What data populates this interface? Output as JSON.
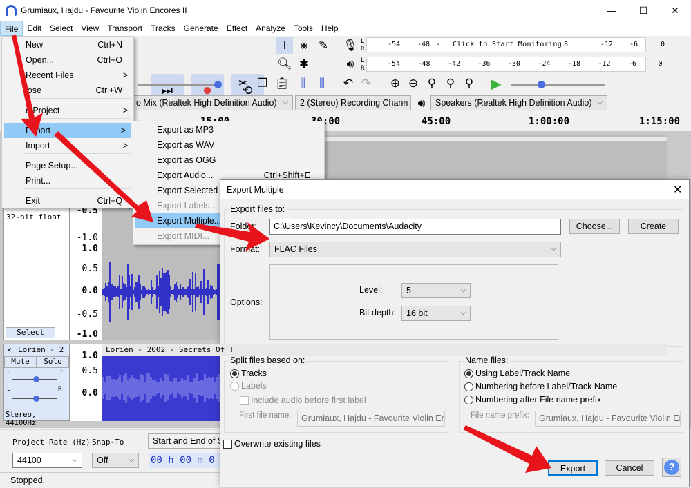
{
  "window": {
    "title": "Grumiaux, Hajdu - Favourite Violin Encores II",
    "minimize": "—",
    "maximize": "☐",
    "close": "✕"
  },
  "menubar": [
    "File",
    "Edit",
    "Select",
    "View",
    "Transport",
    "Tracks",
    "Generate",
    "Effect",
    "Analyze",
    "Tools",
    "Help"
  ],
  "file_menu": {
    "items": [
      {
        "label": "New",
        "shortcut": "Ctrl+N"
      },
      {
        "label": "Open...",
        "shortcut": "Ctrl+O"
      },
      {
        "label": "Recent Files",
        "submenu": ">"
      },
      {
        "label": "lose",
        "shortcut": "Ctrl+W"
      },
      {
        "label": "e Project",
        "submenu": ">"
      },
      {
        "label": "Export",
        "submenu": ">"
      },
      {
        "label": "Import",
        "submenu": ">"
      },
      {
        "label": "Page Setup..."
      },
      {
        "label": "Print..."
      },
      {
        "label": "Exit",
        "shortcut": "Ctrl+Q"
      }
    ]
  },
  "export_submenu": {
    "items": [
      {
        "label": "Export as MP3"
      },
      {
        "label": "Export as WAV"
      },
      {
        "label": "Export as OGG"
      },
      {
        "label": "Export Audio...",
        "shortcut": "Ctrl+Shift+E"
      },
      {
        "label": "Export Selected A"
      },
      {
        "label": "Export Labels...",
        "disabled": true
      },
      {
        "label": "Export Multiple...",
        "highlighted": true
      },
      {
        "label": "Export MIDI...",
        "disabled": true
      }
    ]
  },
  "meters": {
    "record_ticks": [
      "-54",
      "-48",
      "-",
      "8",
      "-12",
      "-6",
      "0"
    ],
    "record_hint": "Click to Start Monitoring",
    "playback_ticks": [
      "-54",
      "-48",
      "-42",
      "-36",
      "-30",
      "-24",
      "-18",
      "-12",
      "-6",
      "0"
    ],
    "lr": [
      "L",
      "R"
    ]
  },
  "devices": {
    "input": "o Mix (Realtek High Definition Audio)",
    "channels": "2 (Stereo) Recording Chann",
    "output": "Speakers (Realtek High Definition Audio)"
  },
  "timeline": [
    "15:00",
    "30:00",
    "45:00",
    "1:00:00",
    "1:15:00"
  ],
  "track1": {
    "info": "32-bit float",
    "select": "Select",
    "scale": [
      "-0.5",
      "-1.0",
      "1.0",
      "0.5",
      "0.0",
      "-0.5",
      "-1.0"
    ]
  },
  "track2": {
    "name": "Lorien - 2",
    "title": "Lorien - 2002 - Secrets Of T",
    "mute": "Mute",
    "solo": "Solo",
    "gain_minus": "-",
    "gain_plus": "+",
    "pan_l": "L",
    "pan_r": "R",
    "info": "Stereo, 44100Hz",
    "scale": [
      "1.0",
      "0.5",
      "0.0"
    ]
  },
  "bottom": {
    "project_rate_label": "Project Rate (Hz)",
    "project_rate": "44100",
    "snap_label": "Snap-To",
    "snap": "Off",
    "selection_label": "Start and End of Se",
    "time": "00 h 00 m 0"
  },
  "status": "Stopped.",
  "dialog": {
    "title": "Export Multiple",
    "export_to": "Export files to:",
    "folder_label": "Folder:",
    "folder": "C:\\Users\\Kevincy\\Documents\\Audacity",
    "choose": "Choose...",
    "create": "Create",
    "format_label": "Format:",
    "format": "FLAC Files",
    "options_label": "Options:",
    "level_label": "Level:",
    "level": "5",
    "bitdepth_label": "Bit depth:",
    "bitdepth": "16 bit",
    "split_label": "Split files based on:",
    "tracks": "Tracks",
    "labels": "Labels",
    "include_audio": "Include audio before first label",
    "first_file_label": "First file name:",
    "first_file": "Grumiaux, Hajdu - Favourite Violin Enc",
    "name_label": "Name files:",
    "name_opt1": "Using Label/Track Name",
    "name_opt2": "Numbering before Label/Track Name",
    "name_opt3": "Numbering after File name prefix",
    "prefix_label": "File name prefix:",
    "prefix": "Grumiaux, Hajdu - Favourite Violin Enc",
    "overwrite": "Overwrite existing files",
    "export": "Export",
    "cancel": "Cancel",
    "help": "?"
  },
  "colors": {
    "accent": "#91c9f7",
    "waveform": "#3232c8",
    "arrow": "#e8141b",
    "record": "#e04040",
    "play": "#3cb43c"
  }
}
